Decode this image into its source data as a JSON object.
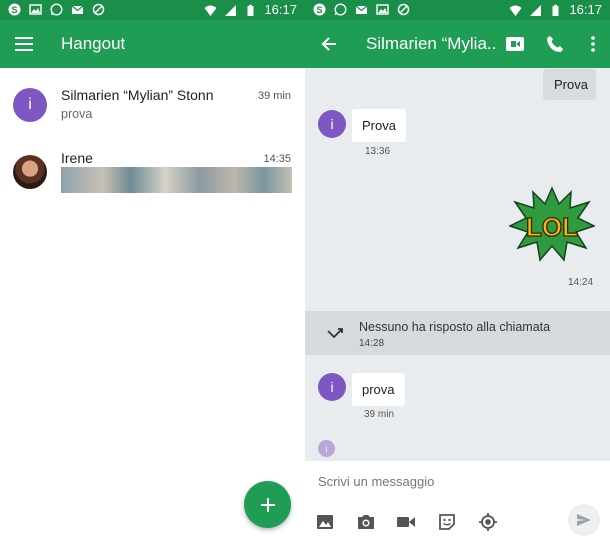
{
  "status_bar": {
    "time": "16:17"
  },
  "left": {
    "title": "Hangout",
    "conversations": [
      {
        "name": "Silmarien “Mylian” Stonn",
        "time": "39 min",
        "snippet": "prova",
        "avatar_letter": "i"
      },
      {
        "name": "Irene",
        "time": "14:35"
      }
    ]
  },
  "right": {
    "title": "Silmarien “Mylia...",
    "messages": {
      "out_1": "Prova",
      "in_1": "Prova",
      "in_1_time": "13:36",
      "sticker_time": "14:24",
      "missed_call": "Nessuno ha risposto alla chiamata",
      "missed_call_time": "14:28",
      "in_2": "prova",
      "in_2_time": "39 min",
      "avatar_letter": "i",
      "sticker_text": "LOL"
    },
    "composer_placeholder": "Scrivi un messaggio"
  },
  "colors": {
    "primary": "#1f9d55",
    "status": "#1a8f4a",
    "avatar": "#7e57c2",
    "chat_bg": "#e9ecef"
  }
}
